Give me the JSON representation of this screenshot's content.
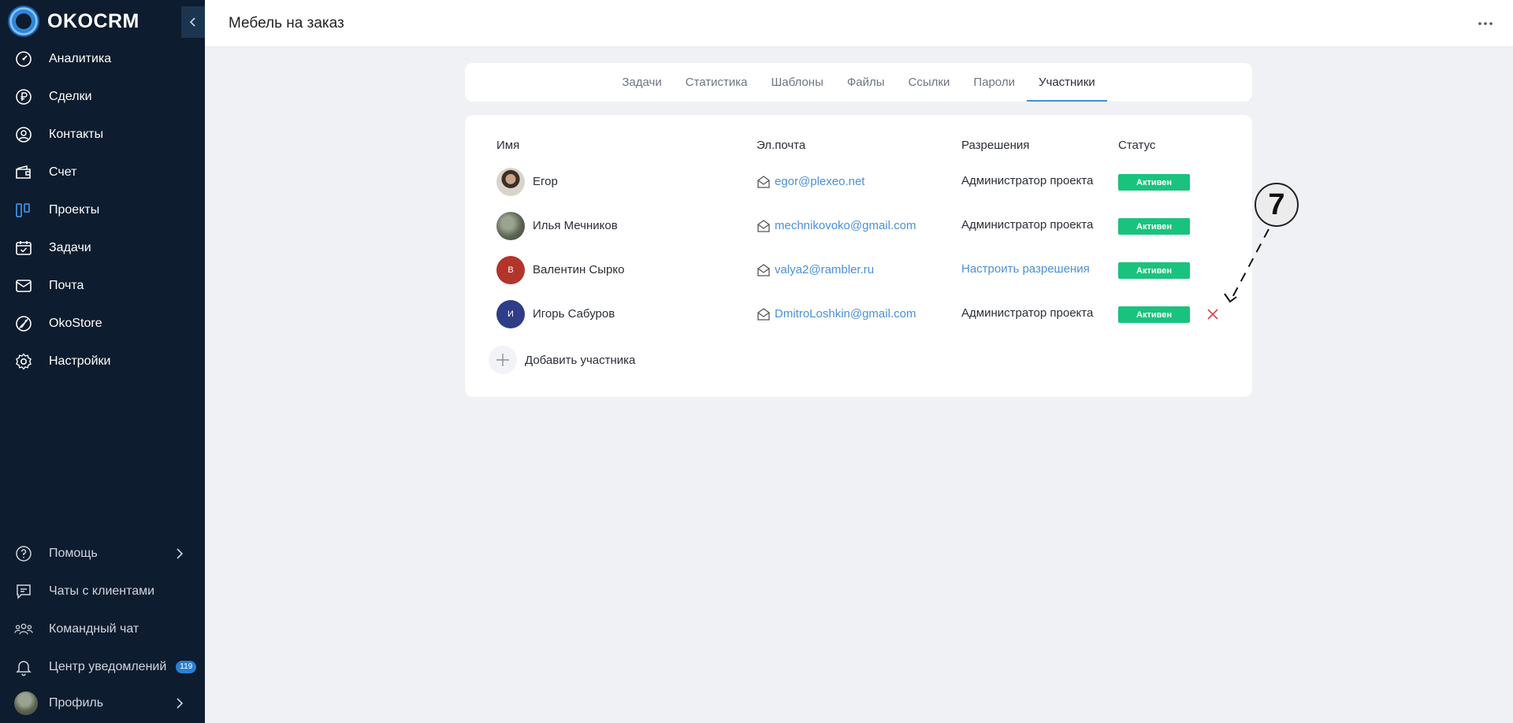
{
  "app": {
    "logo_text": "OKOCRM",
    "page_title": "Мебель на заказ"
  },
  "sidebar": {
    "items": [
      {
        "label": "Аналитика",
        "icon": "analytics-icon"
      },
      {
        "label": "Сделки",
        "icon": "deals-icon"
      },
      {
        "label": "Контакты",
        "icon": "contacts-icon"
      },
      {
        "label": "Счет",
        "icon": "wallet-icon"
      },
      {
        "label": "Проекты",
        "icon": "projects-icon"
      },
      {
        "label": "Задачи",
        "icon": "tasks-icon"
      },
      {
        "label": "Почта",
        "icon": "mail-icon"
      },
      {
        "label": "OkoStore",
        "icon": "store-icon"
      },
      {
        "label": "Настройки",
        "icon": "settings-icon"
      }
    ],
    "bottom": [
      {
        "label": "Помощь",
        "icon": "help-icon"
      },
      {
        "label": "Чаты с клиентами",
        "icon": "chat-icon"
      },
      {
        "label": "Командный чат",
        "icon": "team-icon"
      },
      {
        "label": "Центр уведомлений",
        "icon": "bell-icon",
        "badge": "119"
      },
      {
        "label": "Профиль",
        "icon": "avatar"
      }
    ]
  },
  "tabs": [
    "Задачи",
    "Статистика",
    "Шаблоны",
    "Файлы",
    "Ссылки",
    "Пароли",
    "Участники"
  ],
  "active_tab": "Участники",
  "table": {
    "headers": {
      "name": "Имя",
      "email": "Эл.почта",
      "permissions": "Разрешения",
      "status": "Статус"
    },
    "rows": [
      {
        "name": "Егор",
        "initial": "",
        "avatar_color": "#7a6a5a",
        "email": "egor@plexeo.net",
        "permissions": "Администратор проекта",
        "status": "Активен"
      },
      {
        "name": "Илья Мечников",
        "initial": "",
        "avatar_color": "#6b7260",
        "email": "mechnikovoko@gmail.com",
        "permissions": "Администратор проекта",
        "status": "Активен"
      },
      {
        "name": "Валентин Сырко",
        "initial": "В",
        "avatar_color": "#b3342b",
        "email": "valya2@rambler.ru",
        "permissions": "Настроить разрешения",
        "status": "Активен"
      },
      {
        "name": "Игорь Сабуров",
        "initial": "И",
        "avatar_color": "#2f3c87",
        "email": "DmitroLoshkin@gmail.com",
        "permissions": "Администратор проекта",
        "status": "Активен"
      }
    ],
    "add_label": "Добавить участника"
  },
  "annotation": {
    "number": "7"
  },
  "colors": {
    "sidebar_bg": "#0d1c2e",
    "accent": "#3e8fe0",
    "status_active": "#19c37d",
    "remove": "#e0424b"
  }
}
